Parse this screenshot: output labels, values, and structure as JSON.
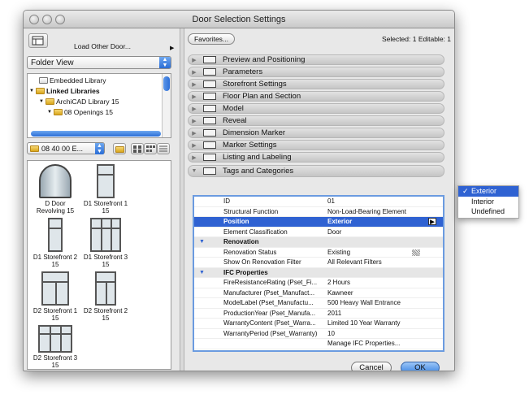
{
  "window": {
    "title": "Door Selection Settings"
  },
  "left": {
    "load_label": "Load Other Door...",
    "view_select": "Folder View",
    "tree": [
      "Embedded Library",
      "Linked Libraries",
      "ArchiCAD Library 15",
      "08 Openings 15"
    ],
    "folder_select": "08 40 00 E...",
    "items": [
      {
        "name": "D Door Revolving 15"
      },
      {
        "name": "D1 Storefront 1 15"
      },
      {
        "name": "D1 Storefront 2 15"
      },
      {
        "name": "D1 Storefront 3 15"
      },
      {
        "name": "D2 Storefront 1 15"
      },
      {
        "name": "D2 Storefront 2 15"
      },
      {
        "name": "D2 Storefront 3 15"
      }
    ]
  },
  "right": {
    "favorites_label": "Favorites...",
    "selection_info": "Selected: 1 Editable: 1",
    "panels": [
      "Preview and Positioning",
      "Parameters",
      "Storefront Settings",
      "Floor Plan and Section",
      "Model",
      "Reveal",
      "Dimension Marker",
      "Marker Settings",
      "Listing and Labeling",
      "Tags and Categories"
    ],
    "table": [
      {
        "k": "ID",
        "v": "01",
        "type": "row"
      },
      {
        "k": "Structural Function",
        "v": "Non-Load-Bearing Element",
        "type": "row"
      },
      {
        "k": "Position",
        "v": "Exterior",
        "type": "selected"
      },
      {
        "k": "Element Classification",
        "v": "Door",
        "type": "row"
      },
      {
        "k": "Renovation",
        "v": "",
        "type": "section"
      },
      {
        "k": "Renovation Status",
        "v": "Existing",
        "type": "row"
      },
      {
        "k": "Show On Renovation Filter",
        "v": "All Relevant Filters",
        "type": "row"
      },
      {
        "k": "IFC Properties",
        "v": "",
        "type": "section"
      },
      {
        "k": "FireResistanceRating (Pset_Fi...",
        "v": "2 Hours",
        "type": "row"
      },
      {
        "k": "Manufacturer (Pset_Manufact...",
        "v": "Kawneer",
        "type": "row"
      },
      {
        "k": "ModelLabel (Pset_Manufactu...",
        "v": "500 Heavy Wall Entrance",
        "type": "row"
      },
      {
        "k": "ProductionYear (Pset_Manufa...",
        "v": "2011",
        "type": "row"
      },
      {
        "k": "WarrantyContent (Pset_Warra...",
        "v": "Limited 10 Year Warranty",
        "type": "row"
      },
      {
        "k": "WarrantyPeriod (Pset_Warranty)",
        "v": "10",
        "type": "row"
      },
      {
        "k": "",
        "v": "Manage IFC Properties...",
        "type": "row"
      }
    ],
    "cancel_label": "Cancel",
    "ok_label": "OK"
  },
  "popup": {
    "options": [
      "Exterior",
      "Interior",
      "Undefined"
    ],
    "selected": "Exterior",
    "check_mark": "✓"
  }
}
